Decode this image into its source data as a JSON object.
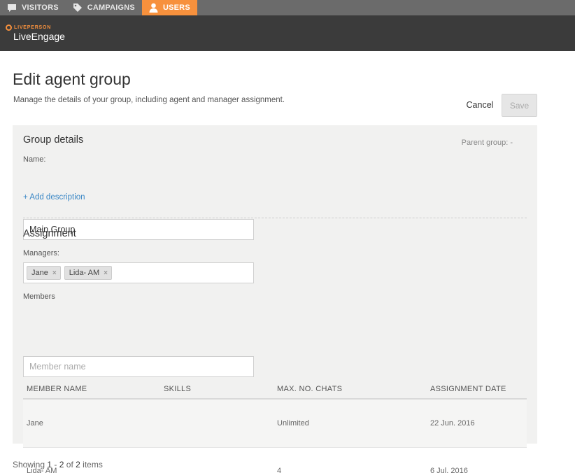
{
  "nav": {
    "tabs": [
      {
        "label": "VISITORS",
        "icon": "chat-bubble-icon"
      },
      {
        "label": "CAMPAIGNS",
        "icon": "tag-icon"
      },
      {
        "label": "USERS",
        "icon": "user-icon",
        "active": true
      }
    ]
  },
  "brand": {
    "company": "LIVEPERSON",
    "product": "LiveEngage"
  },
  "page": {
    "title": "Edit agent group",
    "subtitle": "Manage the details of your group, including agent and manager assignment.",
    "cancel_label": "Cancel",
    "save_label": "Save"
  },
  "group_details": {
    "title": "Group details",
    "parent_group": "Parent group: -",
    "name_label": "Name:",
    "name_value": "Main Group",
    "add_description": "+ Add description"
  },
  "assignment": {
    "title": "Assignment",
    "managers_label": "Managers:",
    "managers": [
      "Jane",
      "Lida- AM"
    ],
    "remove_symbol": "×",
    "members_label": "Members",
    "members_placeholder": "Member name"
  },
  "table": {
    "headers": [
      "MEMBER NAME",
      "SKILLS",
      "MAX. NO. CHATS",
      "ASSIGNMENT DATE"
    ],
    "rows": [
      {
        "name": "Jane",
        "skills": "",
        "max_chats": "Unlimited",
        "date": "22 Jun. 2016"
      },
      {
        "name": "Lida- AM",
        "skills": "",
        "max_chats": "4",
        "date": "6 Jul. 2016"
      }
    ]
  },
  "pagination": {
    "prefix": "Showing",
    "from": "1",
    "sep": "-",
    "to": "2",
    "of": "of",
    "total": "2",
    "suffix": "items"
  },
  "colors": {
    "accent": "#f7913d",
    "link": "#3a87c6",
    "header_bg": "#3b3b3b",
    "nav_bg": "#6b6b6b"
  }
}
